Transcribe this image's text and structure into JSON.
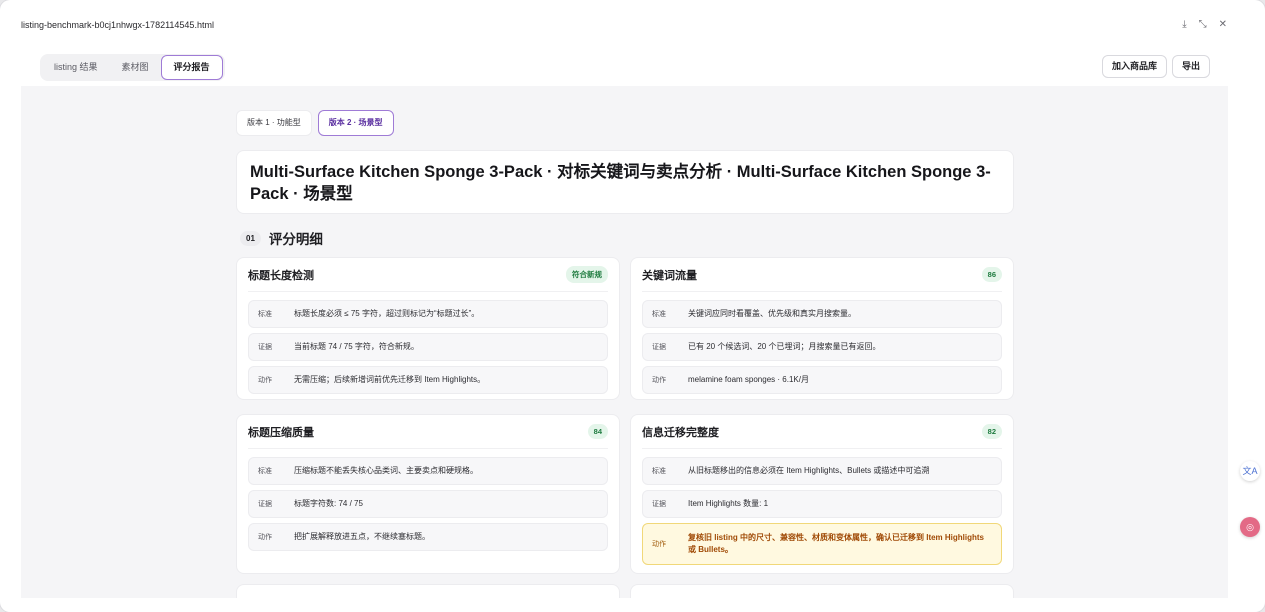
{
  "window": {
    "file_title": "listing-benchmark-b0cj1nhwgx-1782114545.html",
    "icons": [
      "download-icon",
      "collapse-icon",
      "close-icon"
    ]
  },
  "toolbar": {
    "tabs": [
      {
        "label": "listing 结果"
      },
      {
        "label": "素材图"
      },
      {
        "label": "评分报告"
      }
    ],
    "add_to_library_label": "加入商品库",
    "export_label": "导出"
  },
  "report": {
    "version_tabs": [
      {
        "label": "版本 1 · 功能型"
      },
      {
        "label": "版本 2 · 场景型"
      }
    ],
    "headline": "Multi-Surface Kitchen Sponge 3-Pack · 对标关键词与卖点分析 · Multi-Surface Kitchen Sponge 3-Pack · 场景型",
    "section_number": "01",
    "section_title": "评分明细",
    "cards": [
      {
        "title": "标题长度检测",
        "badge": "符合新规",
        "rows": [
          {
            "key": "标准",
            "value": "标题长度必须 ≤ 75 字符，超过则标记为“标题过长”。"
          },
          {
            "key": "证据",
            "value": "当前标题 74 / 75 字符，符合新规。"
          },
          {
            "key": "动作",
            "value": "无需压缩；后续新增词前优先迁移到 Item Highlights。"
          }
        ]
      },
      {
        "title": "关键词流量",
        "badge": "86",
        "rows": [
          {
            "key": "标准",
            "value": "关键词应同时看覆盖、优先级和真实月搜索量。"
          },
          {
            "key": "证据",
            "value": "已有 20 个候选词、20 个已埋词；月搜索量已有返回。"
          },
          {
            "key": "动作",
            "value": "melamine foam sponges · 6.1K/月"
          }
        ]
      },
      {
        "title": "标题压缩质量",
        "badge": "84",
        "rows": [
          {
            "key": "标准",
            "value": "压缩标题不能丢失核心品类词、主要卖点和硬规格。"
          },
          {
            "key": "证据",
            "value": "标题字符数: 74 / 75"
          },
          {
            "key": "动作",
            "value": "把扩展解释放进五点，不继续塞标题。"
          }
        ]
      },
      {
        "title": "信息迁移完整度",
        "badge": "82",
        "rows": [
          {
            "key": "标准",
            "value": "从旧标题移出的信息必须在 Item Highlights、Bullets 或描述中可追溯"
          },
          {
            "key": "证据",
            "value": "Item Highlights 数量: 1"
          },
          {
            "key": "动作",
            "value": "复核旧 listing 中的尺寸、兼容性、材质和变体属性，确认已迁移到 Item Highlights 或 Bullets。"
          }
        ]
      }
    ]
  },
  "side_icons": [
    "translate-icon",
    "assistant-icon"
  ]
}
